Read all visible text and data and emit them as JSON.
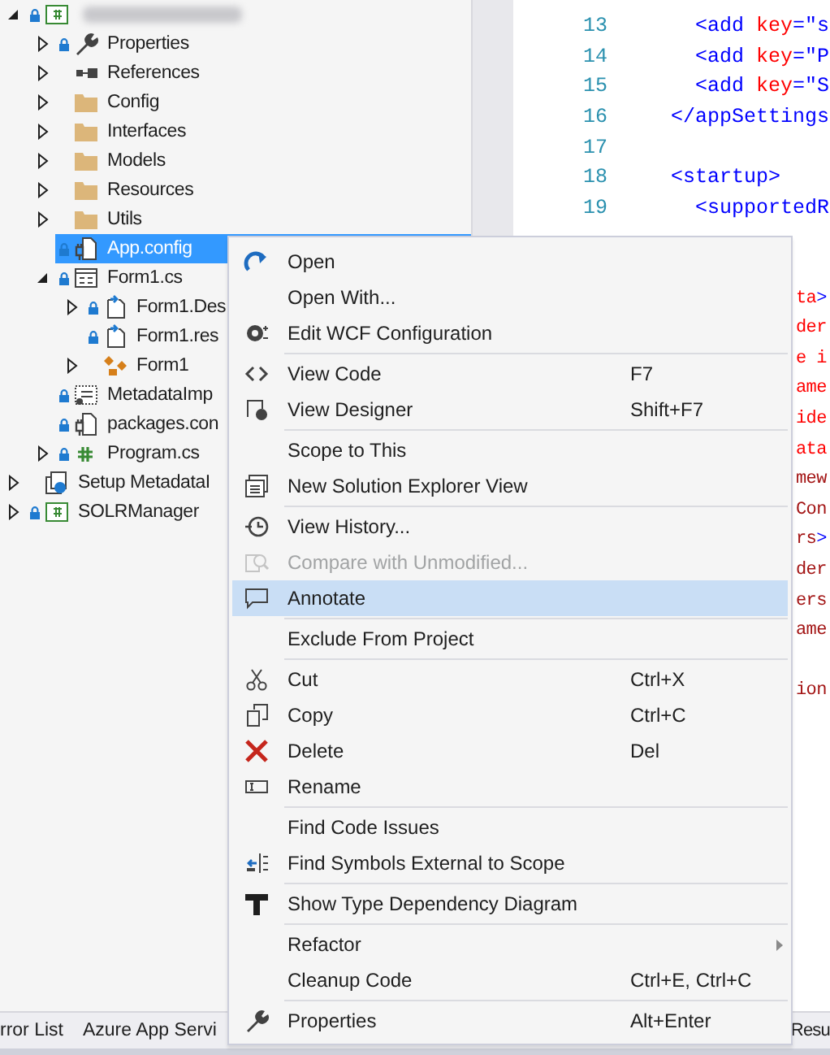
{
  "solution_explorer": {
    "nodes": [
      {
        "kind": "project",
        "label_redacted": true,
        "locked": true,
        "expanded": true,
        "selected": false,
        "children": [
          {
            "kind": "properties",
            "label": "Properties",
            "locked": true,
            "expanded": false,
            "selected": false
          },
          {
            "kind": "references",
            "label": "References",
            "locked": false,
            "expanded": false,
            "selected": false
          },
          {
            "kind": "folder",
            "label": "Config",
            "locked": false,
            "expanded": false,
            "selected": false
          },
          {
            "kind": "folder",
            "label": "Interfaces",
            "locked": false,
            "expanded": false,
            "selected": false
          },
          {
            "kind": "folder",
            "label": "Models",
            "locked": false,
            "expanded": false,
            "selected": false
          },
          {
            "kind": "folder",
            "label": "Resources",
            "locked": false,
            "expanded": false,
            "selected": false
          },
          {
            "kind": "folder",
            "label": "Utils",
            "locked": false,
            "expanded": false,
            "selected": false
          },
          {
            "kind": "config",
            "label": "App.config",
            "locked": true,
            "selected": true
          },
          {
            "kind": "form",
            "label": "Form1.cs",
            "locked": true,
            "expanded": true,
            "selected": false,
            "children": [
              {
                "kind": "dependent",
                "label": "Form1.Des",
                "locked": true,
                "expanded": false,
                "selected": false
              },
              {
                "kind": "dependent",
                "label": "Form1.res",
                "locked": true,
                "selected": false
              },
              {
                "kind": "class",
                "label": "Form1",
                "locked": false,
                "expanded": false,
                "selected": false
              }
            ]
          },
          {
            "kind": "certificate",
            "label": "MetadataImp",
            "locked": true,
            "selected": false
          },
          {
            "kind": "config",
            "label": "packages.con",
            "locked": true,
            "selected": false
          },
          {
            "kind": "csharp",
            "label": "Program.cs",
            "locked": true,
            "expanded": false,
            "selected": false
          }
        ]
      },
      {
        "kind": "setup",
        "label": "Setup MetadataI",
        "locked": false,
        "expanded": false,
        "selected": false
      },
      {
        "kind": "project",
        "label": "SOLRManager",
        "locked": true,
        "expanded": false,
        "selected": false
      }
    ]
  },
  "editor": {
    "lines": [
      {
        "number": "13",
        "indented": true,
        "tokens": [
          {
            "kind": "tag",
            "text": "<add"
          },
          {
            "kind": "attr",
            "text": " key"
          },
          {
            "kind": "tag",
            "text": "=\"s"
          }
        ]
      },
      {
        "number": "14",
        "indented": true,
        "tokens": [
          {
            "kind": "tag",
            "text": "<add"
          },
          {
            "kind": "attr",
            "text": " key"
          },
          {
            "kind": "tag",
            "text": "=\"P"
          }
        ]
      },
      {
        "number": "15",
        "indented": true,
        "tokens": [
          {
            "kind": "tag",
            "text": "<add"
          },
          {
            "kind": "attr",
            "text": " key"
          },
          {
            "kind": "tag",
            "text": "=\"S"
          }
        ]
      },
      {
        "number": "16",
        "indented": false,
        "tokens": [
          {
            "kind": "tag",
            "text": "</appSettings"
          }
        ]
      },
      {
        "number": "17"
      },
      {
        "number": "18",
        "indented": false,
        "tokens": [
          {
            "kind": "tag",
            "text": "<startup>"
          }
        ]
      },
      {
        "number": "19",
        "indented": true,
        "tokens": [
          {
            "kind": "tag",
            "text": "<supportedR"
          }
        ]
      }
    ],
    "fragments": [
      {
        "kind": "blank"
      },
      {
        "kind": "blank"
      },
      {
        "kind": "code",
        "tokens": [
          {
            "kind": "attr",
            "text": "ta"
          },
          {
            "kind": "tag",
            "text": ">"
          }
        ]
      },
      {
        "kind": "code",
        "tokens": [
          {
            "kind": "attr",
            "text": "der"
          }
        ]
      },
      {
        "kind": "code",
        "tokens": [
          {
            "kind": "attr",
            "text": "e i"
          }
        ]
      },
      {
        "kind": "code",
        "tokens": [
          {
            "kind": "attr",
            "text": "ame"
          }
        ]
      },
      {
        "kind": "code",
        "tokens": [
          {
            "kind": "attr",
            "text": "ide"
          }
        ]
      },
      {
        "kind": "code",
        "tokens": [
          {
            "kind": "attr",
            "text": "ata"
          }
        ]
      },
      {
        "kind": "code",
        "tokens": [
          {
            "kind": "element",
            "text": "mew"
          }
        ]
      },
      {
        "kind": "code",
        "tokens": [
          {
            "kind": "element",
            "text": "Con"
          }
        ]
      },
      {
        "kind": "code",
        "tokens": [
          {
            "kind": "element",
            "text": "rs"
          },
          {
            "kind": "tag",
            "text": ">"
          }
        ]
      },
      {
        "kind": "code",
        "tokens": [
          {
            "kind": "element",
            "text": "der"
          }
        ]
      },
      {
        "kind": "code",
        "tokens": [
          {
            "kind": "element",
            "text": "ers"
          }
        ]
      },
      {
        "kind": "code",
        "tokens": [
          {
            "kind": "element",
            "text": "ame"
          }
        ]
      },
      {
        "kind": "blank"
      },
      {
        "kind": "code",
        "tokens": [
          {
            "kind": "element",
            "text": "ion"
          }
        ]
      }
    ]
  },
  "bottom_tabs": [
    {
      "label": "rror List"
    },
    {
      "label": "Azure App Servi"
    },
    {
      "label": "Resu"
    }
  ],
  "context_menu": {
    "items": [
      {
        "kind": "command",
        "label": "Open",
        "disabled": false,
        "selected": false,
        "submenu": false
      },
      {
        "kind": "command",
        "label": "Open With...",
        "disabled": false,
        "selected": false,
        "submenu": false
      },
      {
        "kind": "command",
        "label": "Edit WCF Configuration",
        "disabled": false,
        "selected": false,
        "submenu": false
      },
      {
        "kind": "separator"
      },
      {
        "kind": "command",
        "label": "View Code",
        "shortcut": "F7",
        "disabled": false,
        "selected": false,
        "submenu": false
      },
      {
        "kind": "command",
        "label": "View Designer",
        "shortcut": "Shift+F7",
        "disabled": false,
        "selected": false,
        "submenu": false
      },
      {
        "kind": "separator"
      },
      {
        "kind": "command",
        "label": "Scope to This",
        "disabled": false,
        "selected": false,
        "submenu": false
      },
      {
        "kind": "command",
        "label": "New Solution Explorer View",
        "disabled": false,
        "selected": false,
        "submenu": false
      },
      {
        "kind": "separator"
      },
      {
        "kind": "command",
        "label": "View History...",
        "disabled": false,
        "selected": false,
        "submenu": false
      },
      {
        "kind": "command",
        "label": "Compare with Unmodified...",
        "disabled": true,
        "selected": false,
        "submenu": false
      },
      {
        "kind": "command",
        "label": "Annotate",
        "disabled": false,
        "selected": true,
        "submenu": false
      },
      {
        "kind": "separator"
      },
      {
        "kind": "command",
        "label": "Exclude From Project",
        "disabled": false,
        "selected": false,
        "submenu": false
      },
      {
        "kind": "separator"
      },
      {
        "kind": "command",
        "label": "Cut",
        "shortcut": "Ctrl+X",
        "disabled": false,
        "selected": false,
        "submenu": false
      },
      {
        "kind": "command",
        "label": "Copy",
        "shortcut": "Ctrl+C",
        "disabled": false,
        "selected": false,
        "submenu": false
      },
      {
        "kind": "command",
        "label": "Delete",
        "shortcut": "Del",
        "disabled": false,
        "selected": false,
        "submenu": false
      },
      {
        "kind": "command",
        "label": "Rename",
        "disabled": false,
        "selected": false,
        "submenu": false
      },
      {
        "kind": "separator"
      },
      {
        "kind": "command",
        "label": "Find Code Issues",
        "disabled": false,
        "selected": false,
        "submenu": false
      },
      {
        "kind": "command",
        "label": "Find Symbols External to Scope",
        "disabled": false,
        "selected": false,
        "submenu": false
      },
      {
        "kind": "separator"
      },
      {
        "kind": "command",
        "label": "Show Type Dependency Diagram",
        "disabled": false,
        "selected": false,
        "submenu": false
      },
      {
        "kind": "separator"
      },
      {
        "kind": "command",
        "label": "Refactor",
        "disabled": false,
        "selected": false,
        "submenu": true
      },
      {
        "kind": "command",
        "label": "Cleanup Code",
        "shortcut": "Ctrl+E, Ctrl+C",
        "disabled": false,
        "selected": false,
        "submenu": false
      },
      {
        "kind": "separator"
      },
      {
        "kind": "command",
        "label": "Properties",
        "shortcut": "Alt+Enter",
        "disabled": false,
        "selected": false,
        "submenu": false
      }
    ]
  }
}
